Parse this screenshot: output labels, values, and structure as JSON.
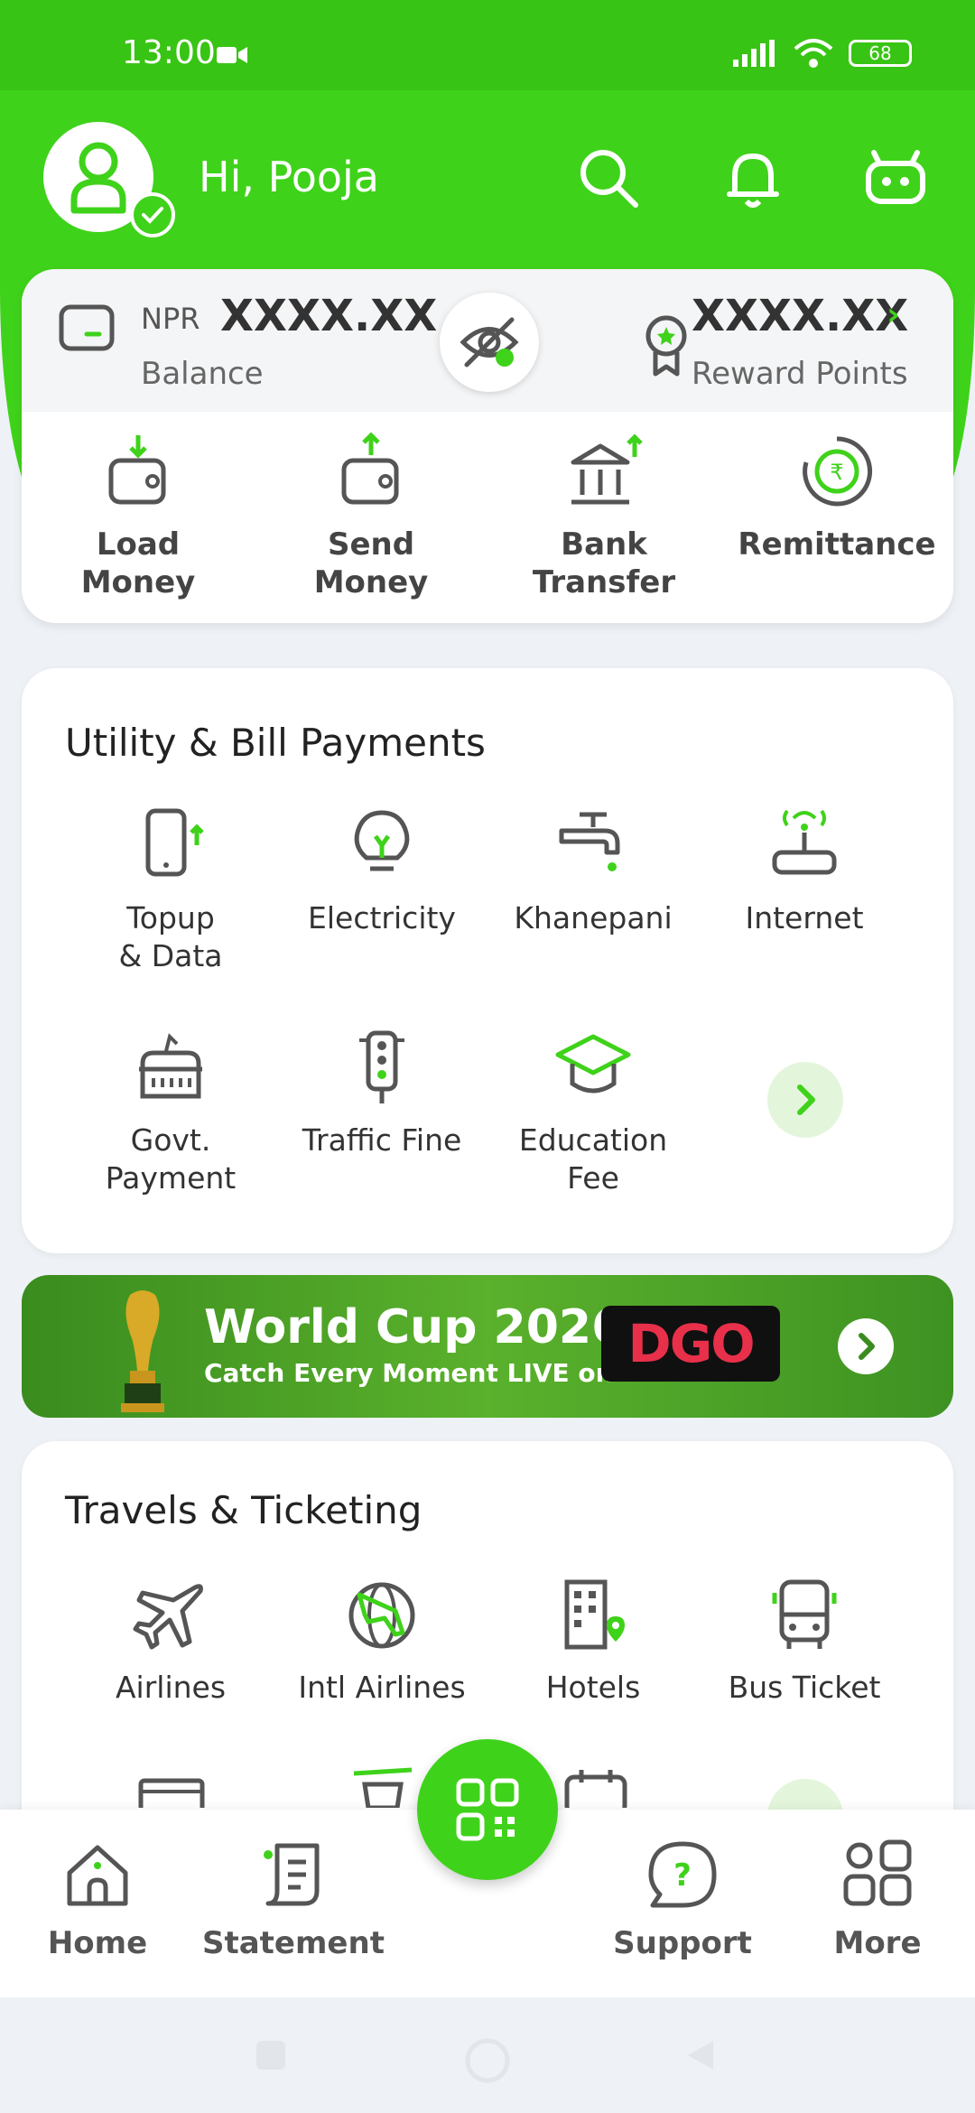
{
  "status": {
    "time": "13:00",
    "battery": "68"
  },
  "header": {
    "greeting": "Hi, Pooja"
  },
  "balance": {
    "currency": "NPR",
    "amount": "XXXX.XX",
    "label": "Balance"
  },
  "rewards": {
    "amount": "XXXX.XX",
    "label": "Reward Points",
    "chevron": "›"
  },
  "quick_actions": [
    {
      "label1": "Load",
      "label2": "Money"
    },
    {
      "label1": "Send",
      "label2": "Money"
    },
    {
      "label1": "Bank",
      "label2": "Transfer"
    },
    {
      "label1": "Remittance",
      "label2": ""
    }
  ],
  "utility": {
    "title": "Utility & Bill Payments",
    "items": [
      {
        "label1": "Topup",
        "label2": "& Data"
      },
      {
        "label1": "Electricity",
        "label2": ""
      },
      {
        "label1": "Khanepani",
        "label2": ""
      },
      {
        "label1": "Internet",
        "label2": ""
      },
      {
        "label1": "Govt.",
        "label2": "Payment"
      },
      {
        "label1": "Traffic Fine",
        "label2": ""
      },
      {
        "label1": "Education",
        "label2": "Fee"
      }
    ]
  },
  "banner": {
    "title": "World Cup 2026",
    "subtitle": "Catch Every Moment LIVE on",
    "brand": "DGO"
  },
  "travels": {
    "title": "Travels & Ticketing",
    "items": [
      {
        "label": "Airlines"
      },
      {
        "label": "Intl Airlines"
      },
      {
        "label": "Hotels"
      },
      {
        "label": "Bus Ticket"
      }
    ]
  },
  "nav": {
    "home": "Home",
    "statement": "Statement",
    "support": "Support",
    "more": "More"
  },
  "colors": {
    "primary": "#3fd21a",
    "primary_dark": "#38c414",
    "icon": "#555555"
  }
}
